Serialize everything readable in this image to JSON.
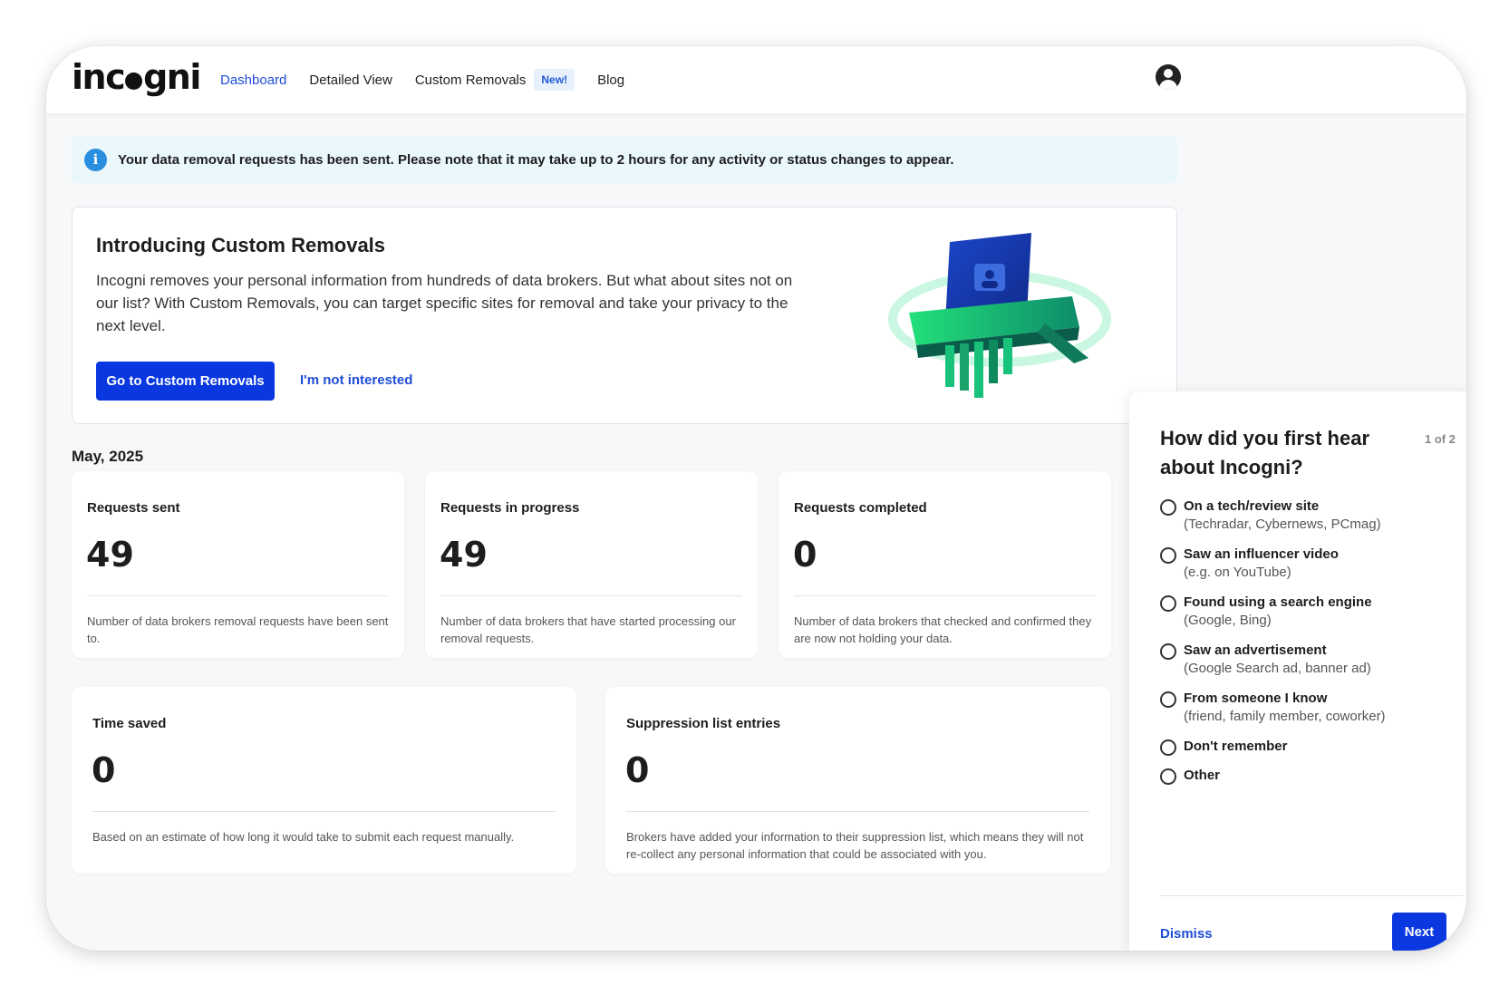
{
  "app": {
    "logo_text_1": "inc",
    "logo_text_2": "gni"
  },
  "nav": {
    "items": [
      {
        "label": "Dashboard",
        "active": true
      },
      {
        "label": "Detailed View",
        "active": false
      },
      {
        "label": "Custom Removals",
        "active": false
      },
      {
        "label": "Blog",
        "active": false
      }
    ],
    "badge": "New!"
  },
  "banner": {
    "text": "Your data removal requests has been sent. Please note that it may take up to 2 hours for any activity or status changes to appear."
  },
  "promo": {
    "title": "Introducing Custom Removals",
    "body": "Incogni removes your personal information from hundreds of data brokers. But what about sites not on our list? With Custom Removals, you can target specific sites for removal and take your privacy to the next level.",
    "primary_label": "Go to Custom Removals",
    "secondary_label": "I'm not interested"
  },
  "month": "May, 2025",
  "stats": [
    {
      "label": "Requests sent",
      "value": "49",
      "desc": "Number of data brokers removal requests have been sent to."
    },
    {
      "label": "Requests in progress",
      "value": "49",
      "desc": "Number of data brokers that have started processing our removal requests."
    },
    {
      "label": "Requests completed",
      "value": "0",
      "desc": "Number of data brokers that checked and confirmed they are now not holding your data."
    },
    {
      "label": "Time saved",
      "value": "0",
      "desc": "Based on an estimate of how long it would take to submit each request manually."
    },
    {
      "label": "Suppression list entries",
      "value": "0",
      "desc": "Brokers have added your information to their suppression list, which means they will not re-collect any personal information that could be associated with you."
    }
  ],
  "survey": {
    "title": "How did you first hear about Incogni?",
    "step": "1 of 2",
    "options": [
      {
        "label": "On a tech/review site",
        "sub": "(Techradar, Cybernews, PCmag)"
      },
      {
        "label": "Saw an influencer video",
        "sub": "(e.g. on YouTube)"
      },
      {
        "label": "Found using a search engine",
        "sub": "(Google, Bing)"
      },
      {
        "label": "Saw an advertisement",
        "sub": "(Google Search ad, banner ad)"
      },
      {
        "label": "From someone I know",
        "sub": "(friend, family member, coworker)"
      },
      {
        "label": "Don't remember",
        "sub": ""
      },
      {
        "label": "Other",
        "sub": ""
      }
    ],
    "dismiss_label": "Dismiss",
    "next_label": "Next"
  },
  "colors": {
    "accent": "#0a38e0",
    "link": "#1e4dd8",
    "banner_bg": "#eaf7fb",
    "info": "#2a8ee0"
  }
}
